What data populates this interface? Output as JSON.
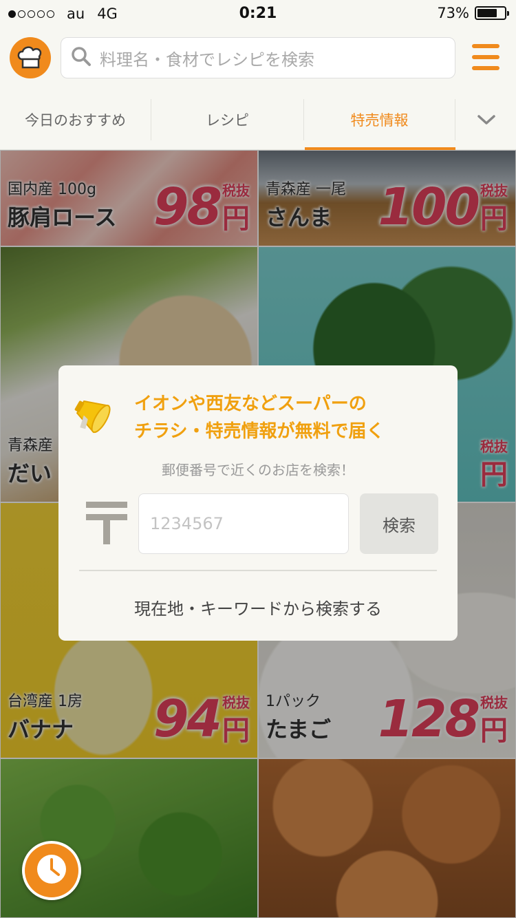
{
  "status_bar": {
    "carrier": "au",
    "network": "4G",
    "time": "0:21",
    "battery": "73%",
    "battery_level": 0.73
  },
  "header": {
    "search_placeholder": "料理名・食材でレシピを検索"
  },
  "tabs": [
    {
      "label": "今日のおすすめ"
    },
    {
      "label": "レシピ"
    },
    {
      "label": "特売情報",
      "active": true
    }
  ],
  "products": [
    {
      "origin": "国内産 100g",
      "name": "豚肩ロース",
      "price": "98",
      "tax": "税抜",
      "yen": "円"
    },
    {
      "origin": "青森産 一尾",
      "name": "さんま",
      "price": "100",
      "tax": "税抜",
      "yen": "円"
    },
    {
      "origin": "青森産",
      "name": "だい",
      "price": "",
      "tax": "",
      "yen": ""
    },
    {
      "origin": "",
      "name": "",
      "price": "",
      "tax": "税抜",
      "yen": "円"
    },
    {
      "origin": "台湾産 1房",
      "name": "バナナ",
      "price": "94",
      "tax": "税抜",
      "yen": "円"
    },
    {
      "origin": "1パック",
      "name": "たまご",
      "price": "128",
      "tax": "税抜",
      "yen": "円"
    }
  ],
  "modal": {
    "headline_line1": "イオンや西友などスーパーの",
    "headline_line2": "チラシ・特売情報が無料で届く",
    "subtext": "郵便番号で近くのお店を検索！",
    "postal_placeholder": "1234567",
    "search_button": "検索",
    "location_link": "現在地・キーワードから検索する"
  },
  "colors": {
    "accent": "#f08a1c",
    "headline": "#f0a00f",
    "price": "#e4405c"
  },
  "icons": {
    "logo": "chef-hat-icon",
    "search": "search-icon",
    "menu": "hamburger-menu-icon",
    "chevron": "chevron-down-icon",
    "megaphone": "megaphone-icon",
    "postal": "postal-mark-icon",
    "history": "clock-icon"
  }
}
